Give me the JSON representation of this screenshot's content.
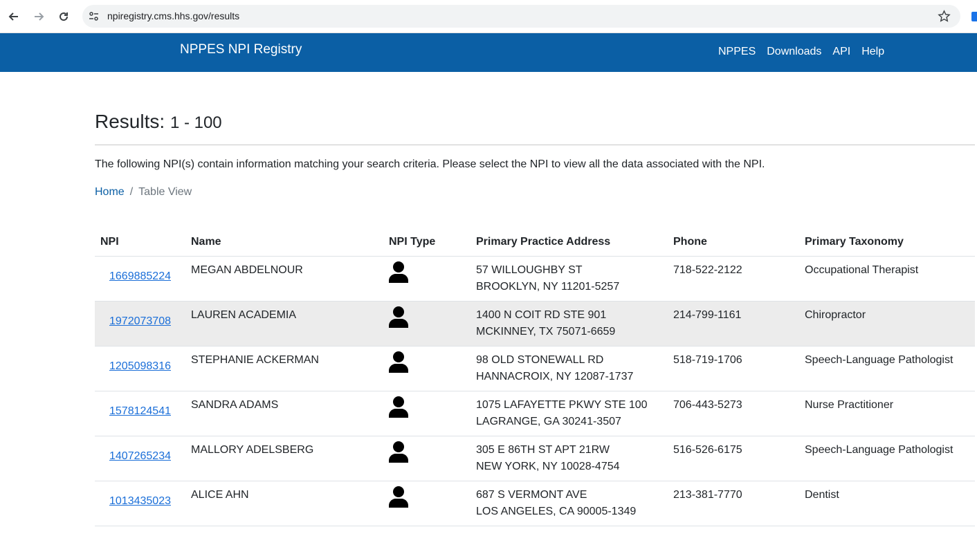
{
  "browser": {
    "url": "npiregistry.cms.hhs.gov/results"
  },
  "header": {
    "brand": "NPPES NPI Registry",
    "nav": [
      "NPPES",
      "Downloads",
      "API",
      "Help"
    ]
  },
  "main": {
    "title_prefix": "Results:",
    "title_range": "1 - 100",
    "intro": "The following NPI(s) contain information matching your search criteria. Please select the NPI to view all the data associated with the NPI.",
    "breadcrumb": {
      "home": "Home",
      "separator": "/",
      "current": "Table View"
    }
  },
  "table": {
    "headers": [
      "NPI",
      "Name",
      "NPI Type",
      "Primary Practice Address",
      "Phone",
      "Primary Taxonomy"
    ],
    "rows": [
      {
        "npi": "1669885224",
        "name": "MEGAN ABDELNOUR",
        "type_icon": "person-icon",
        "address1": "57 WILLOUGHBY ST",
        "address2": "BROOKLYN, NY 11201-5257",
        "phone": "718-522-2122",
        "taxonomy": "Occupational Therapist"
      },
      {
        "npi": "1972073708",
        "name": "LAUREN ACADEMIA",
        "type_icon": "person-icon",
        "address1": "1400 N COIT RD STE 901",
        "address2": "MCKINNEY, TX 75071-6659",
        "phone": "214-799-1161",
        "taxonomy": "Chiropractor"
      },
      {
        "npi": "1205098316",
        "name": "STEPHANIE ACKERMAN",
        "type_icon": "person-icon",
        "address1": "98 OLD STONEWALL RD",
        "address2": "HANNACROIX, NY 12087-1737",
        "phone": "518-719-1706",
        "taxonomy": "Speech-Language Pathologist"
      },
      {
        "npi": "1578124541",
        "name": "SANDRA ADAMS",
        "type_icon": "person-icon",
        "address1": "1075 LAFAYETTE PKWY STE 100",
        "address2": "LAGRANGE, GA 30241-3507",
        "phone": "706-443-5273",
        "taxonomy": "Nurse Practitioner"
      },
      {
        "npi": "1407265234",
        "name": "MALLORY ADELSBERG",
        "type_icon": "person-icon",
        "address1": "305 E 86TH ST APT 21RW",
        "address2": "NEW YORK, NY 10028-4754",
        "phone": "516-526-6175",
        "taxonomy": "Speech-Language Pathologist"
      },
      {
        "npi": "1013435023",
        "name": "ALICE AHN",
        "type_icon": "person-icon",
        "address1": "687 S VERMONT AVE",
        "address2": "LOS ANGELES, CA 90005-1349",
        "phone": "213-381-7770",
        "taxonomy": "Dentist"
      }
    ]
  },
  "colors": {
    "header_bg": "#0b5fa5",
    "link": "#1a6ed8",
    "stripe": "#ececec"
  }
}
